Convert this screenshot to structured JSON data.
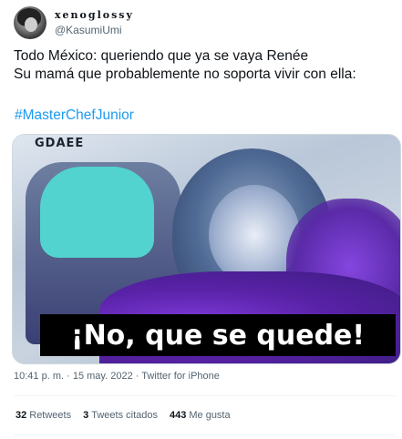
{
  "author": {
    "display_name": "xenoglossy",
    "handle": "@KasumiUmi"
  },
  "tweet": {
    "line1": "Todo México: queriendo que ya se vaya Renée",
    "line2": "Su mamá que probablemente no soporta vivir con ella:",
    "hashtag": "#MasterChefJunior"
  },
  "media": {
    "logo_text": "GDAEE",
    "caption": "¡No, que se quede!"
  },
  "meta": {
    "time": "10:41 p. m.",
    "sep": "·",
    "date": "15 may. 2022",
    "source": "Twitter for iPhone"
  },
  "stats": {
    "retweets_count": "32",
    "retweets_label": "Retweets",
    "quotes_count": "3",
    "quotes_label": "Tweets citados",
    "likes_count": "443",
    "likes_label": "Me gusta"
  }
}
